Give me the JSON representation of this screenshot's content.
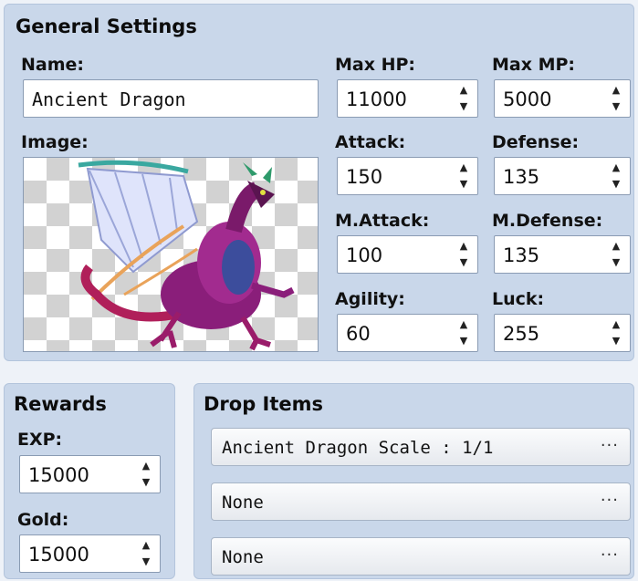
{
  "general": {
    "title": "General Settings",
    "name_label": "Name:",
    "name_value": "Ancient Dragon",
    "image_label": "Image:",
    "stats": {
      "max_hp": {
        "label": "Max HP:",
        "value": "11000"
      },
      "max_mp": {
        "label": "Max MP:",
        "value": "5000"
      },
      "attack": {
        "label": "Attack:",
        "value": "150"
      },
      "defense": {
        "label": "Defense:",
        "value": "135"
      },
      "m_attack": {
        "label": "M.Attack:",
        "value": "100"
      },
      "m_defense": {
        "label": "M.Defense:",
        "value": "135"
      },
      "agility": {
        "label": "Agility:",
        "value": "60"
      },
      "luck": {
        "label": "Luck:",
        "value": "255"
      }
    }
  },
  "rewards": {
    "title": "Rewards",
    "exp_label": "EXP:",
    "exp_value": "15000",
    "gold_label": "Gold:",
    "gold_value": "15000"
  },
  "drops": {
    "title": "Drop Items",
    "items": [
      "Ancient Dragon Scale : 1/1",
      "None",
      "None"
    ],
    "more_glyph": "···"
  },
  "icons": {
    "spin_up": "▲",
    "spin_down": "▼"
  },
  "colors": {
    "panel": "#c9d7ea",
    "field_border": "#8a9bb3",
    "background": "#eef2f8"
  }
}
